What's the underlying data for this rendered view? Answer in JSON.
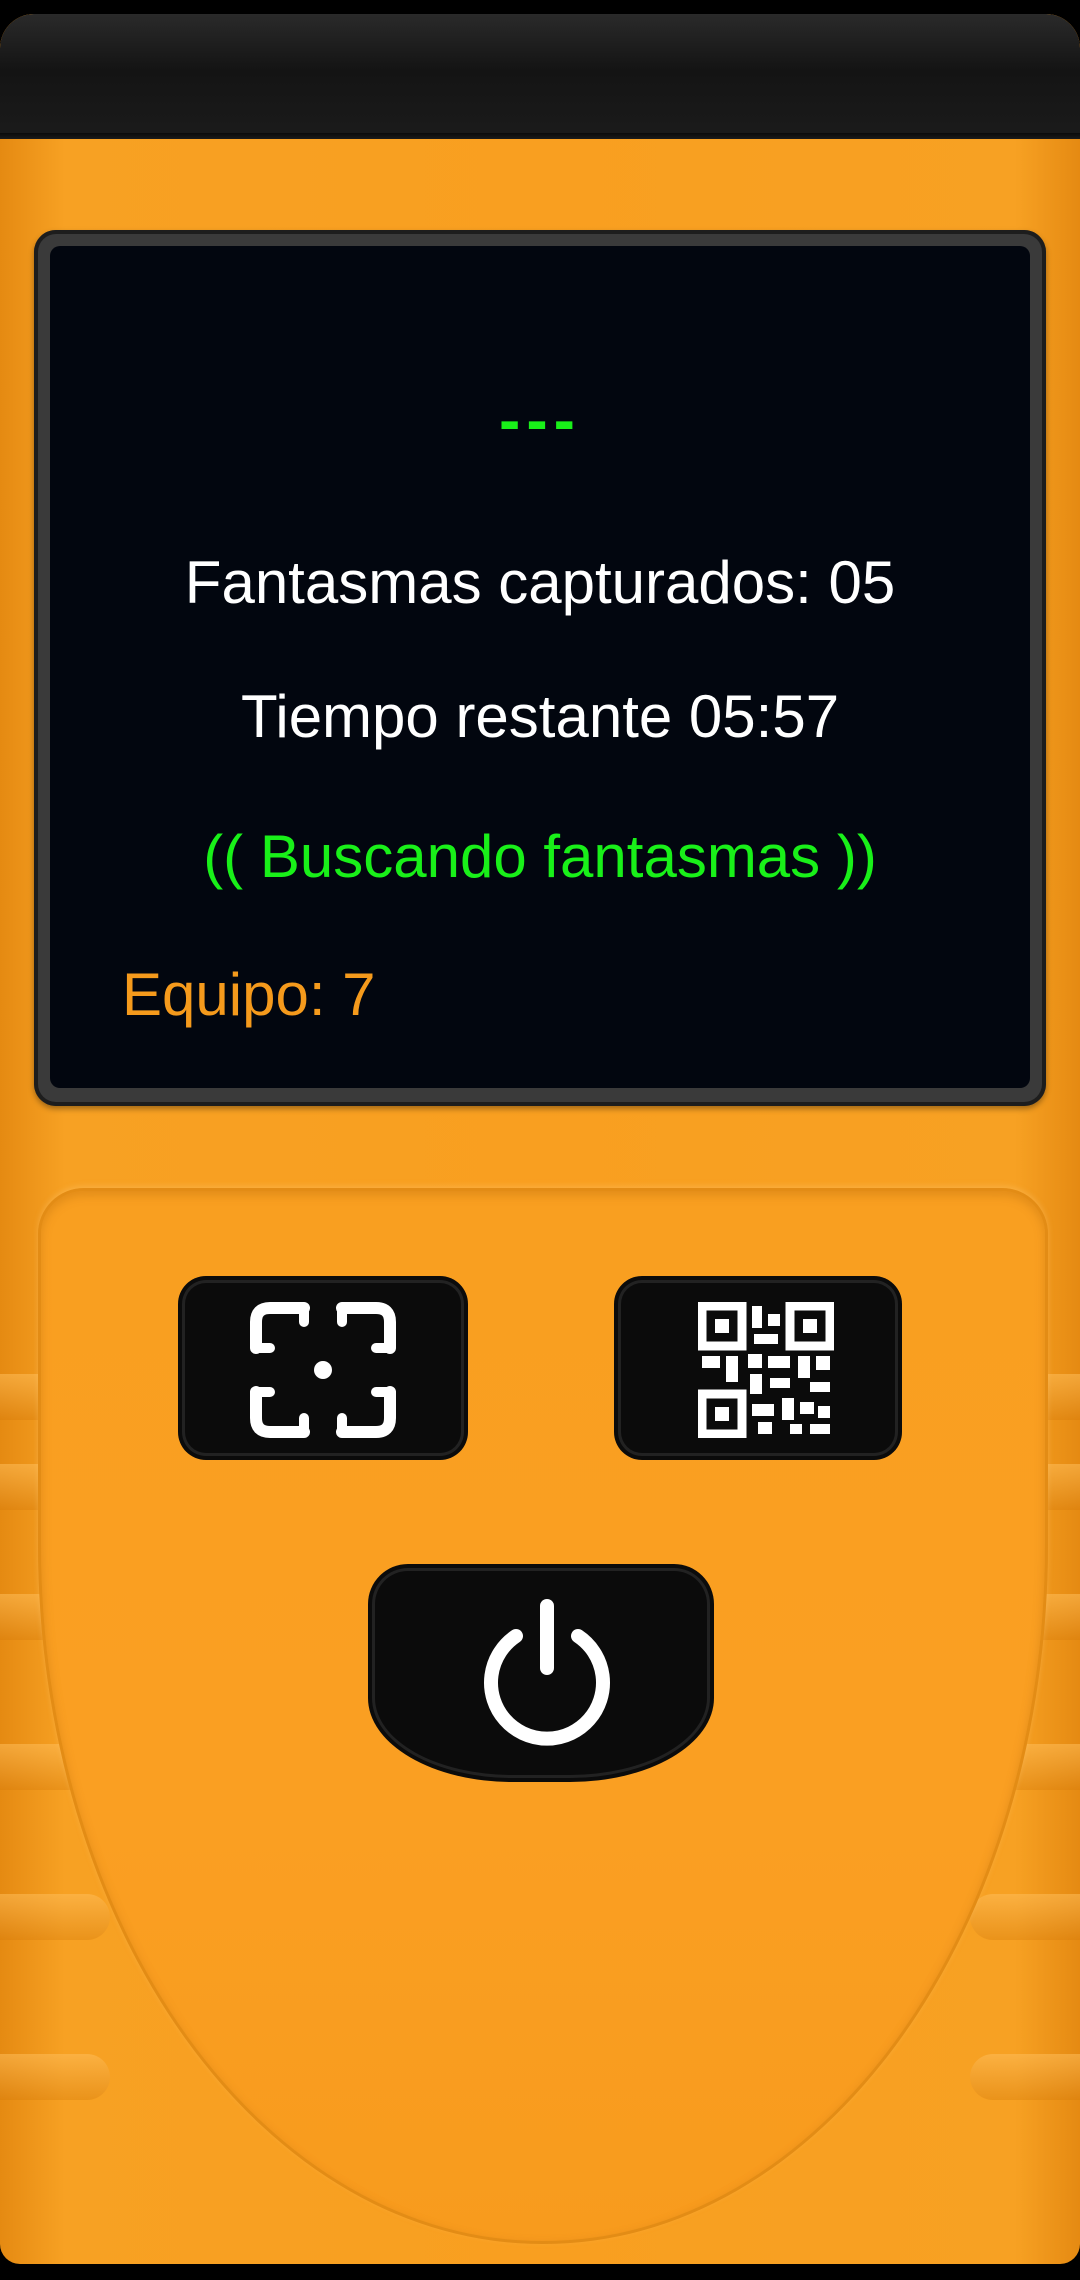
{
  "screen": {
    "signal_indicator": "---",
    "captured_label": "Fantasmas capturados: 05",
    "time_label": "Tiempo restante 05:57",
    "status_text": "(( Buscando fantasmas ))",
    "team_label": "Equipo: 7"
  },
  "buttons": {
    "scan": {
      "icon": "scan-target-icon"
    },
    "qr": {
      "icon": "qr-code-icon"
    },
    "power": {
      "icon": "power-icon"
    }
  },
  "colors": {
    "device_body": "#f99f20",
    "screen_background": "#02060f",
    "signal_green": "#19f019",
    "text_white": "#ffffff",
    "team_orange": "#f59a1c",
    "button_black": "#0b0b0b"
  }
}
